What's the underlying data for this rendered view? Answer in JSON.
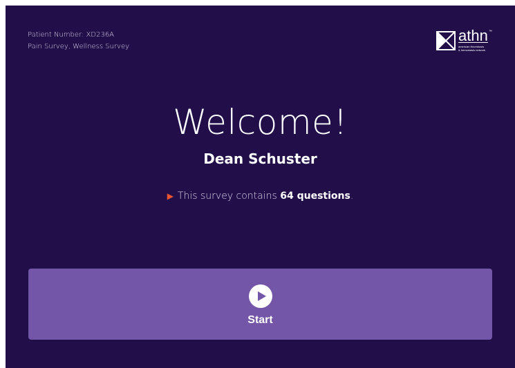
{
  "header": {
    "patient_number": "Patient Number: XD236A",
    "surveys": "Pain Survey, Wellness Survey"
  },
  "logo": {
    "wordmark": "athn",
    "trademark": "™",
    "tagline_line1": "american thrombosis",
    "tagline_line2": "& hemostasis network",
    "icon": "athn-logo-icon"
  },
  "main": {
    "welcome": "Welcome!",
    "patient_name": "Dean Schuster",
    "survey_prefix": "This survey contains ",
    "question_count": "64 questions",
    "survey_suffix": "."
  },
  "start_button": {
    "label": "Start",
    "icon": "play-circle-icon"
  },
  "colors": {
    "background": "#220f4a",
    "button": "#7356a8",
    "accent_arrow": "#e8552f",
    "text": "#ffffff"
  }
}
